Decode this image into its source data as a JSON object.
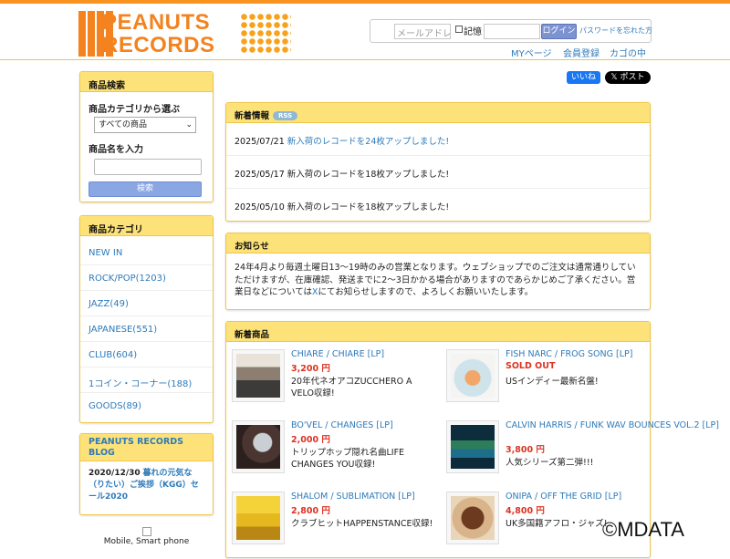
{
  "header": {
    "logo_line1": "PEANUTS",
    "logo_line2": "RECORDS",
    "login": {
      "email_placeholder": "メールアドレ",
      "remember_label": "記憶",
      "login_button": "ログイン",
      "forgot_link": "パスワードを忘れた方"
    },
    "links": [
      "MYページ",
      "会員登録",
      "カゴの中"
    ]
  },
  "social": {
    "facebook": "いいね",
    "x_post": "ポスト"
  },
  "sidebar": {
    "search": {
      "title": "商品検索",
      "category_label": "商品カテゴリから選ぶ",
      "category_value": "すべての商品",
      "name_label": "商品名を入力",
      "search_button": "検索"
    },
    "categories": {
      "title": "商品カテゴリ",
      "items": [
        "NEW IN",
        "ROCK/POP(1203)",
        "JAZZ(49)",
        "JAPANESE(551)",
        "CLUB(604)",
        "1コイン・コーナー(188)",
        "GOODS(89)"
      ]
    },
    "blog": {
      "title": "PEANUTS RECORDS BLOG",
      "entry_date": "2020/12/30",
      "entry_title": "暮れの元気な（りたい）ご挨拶（KGG）セール2020"
    },
    "mobile_label": "Mobile, Smart phone"
  },
  "news": {
    "title": "新着情報",
    "rss": "RSS",
    "items": [
      {
        "date": "2025/07/21",
        "title": "新入荷のレコードを24枚アップしました!",
        "link": true
      },
      {
        "date": "2025/05/17",
        "title": "新入荷のレコードを18枚アップしました!",
        "link": false
      },
      {
        "date": "2025/05/10",
        "title": "新入荷のレコードを18枚アップしました!",
        "link": false
      }
    ]
  },
  "notice": {
    "title": "お知らせ",
    "text": "24年4月より毎週土曜日13～19時のみの営業となります。ウェブショップでのご注文は通常通りしていただけますが、在庫確認、発送までに2～3日かかる場合がありますのであらかじめご了承ください。営業日などについては",
    "link_text": "X",
    "text_after": "にてお知らせしますので、よろしくお願いいたします。"
  },
  "new_products": {
    "title": "新着商品",
    "items": [
      {
        "title": "CHIARE / CHIARE [LP]",
        "price": "3,200 円",
        "desc": "20年代ネオアコZUCCHERO A VELO収録!"
      },
      {
        "title": "FISH NARC / FROG SONG [LP]",
        "price": "SOLD OUT",
        "desc": "USインディー最新名盤!"
      },
      {
        "title": "BO'VEL / CHANGES [LP]",
        "price": "2,000 円",
        "desc": "トリップホップ隠れ名曲LIFE CHANGES YOU収録!"
      },
      {
        "title": "CALVIN HARRIS / FUNK WAV BOUNCES VOL.2 [LP]",
        "price": "3,800 円",
        "desc": "人気シリーズ第二弾!!!"
      },
      {
        "title": "SHALOM / SUBLIMATION [LP]",
        "price": "2,800 円",
        "desc": "クラブヒットHAPPENSTANCE収録!"
      },
      {
        "title": "ONIPA / OFF THE GRID [LP]",
        "price": "4,800 円",
        "desc": "UK多国籍アフロ・ジャズ!"
      }
    ]
  },
  "watermark": "©MDATA"
}
